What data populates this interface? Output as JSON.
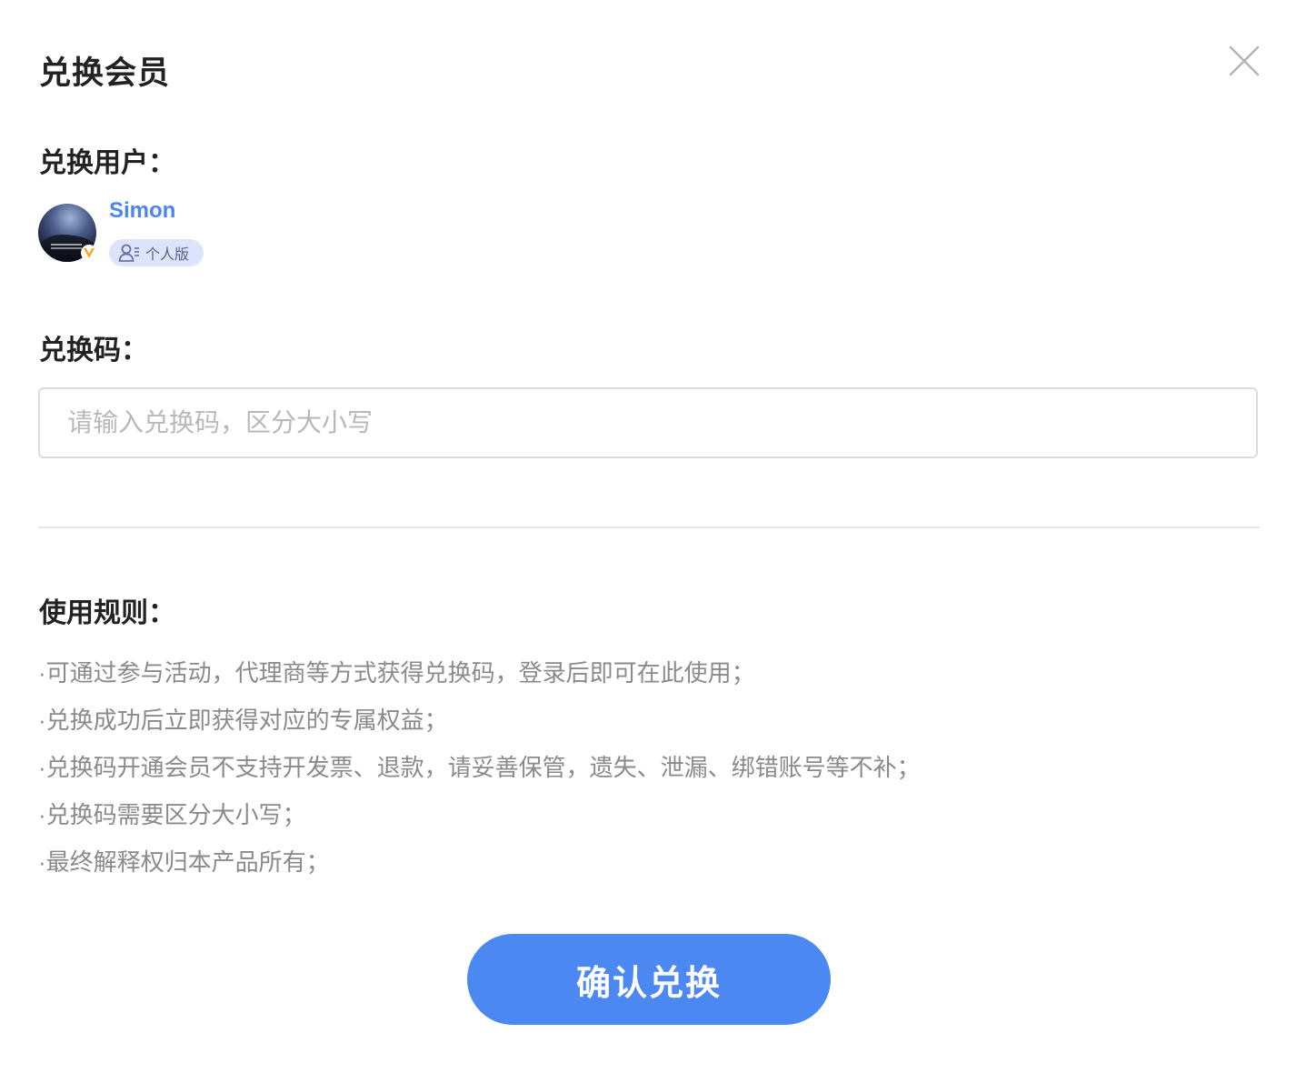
{
  "dialog": {
    "title": "兑换会员",
    "close_icon": "close-icon"
  },
  "user_section": {
    "label": "兑换用户：",
    "username": "Simon",
    "edition": "个人版",
    "edition_icon": "user-list-icon",
    "vip_icon": "vip-badge-icon"
  },
  "code_section": {
    "label": "兑换码：",
    "input_value": "",
    "placeholder": "请输入兑换码，区分大小写"
  },
  "rules": {
    "label": "使用规则：",
    "items": [
      "·可通过参与活动，代理商等方式获得兑换码，登录后即可在此使用；",
      "·兑换成功后立即获得对应的专属权益；",
      "·兑换码开通会员不支持开发票、退款，请妥善保管，遗失、泄漏、绑错账号等不补；",
      "·兑换码需要区分大小写；",
      "·最终解释权归本产品所有；"
    ]
  },
  "actions": {
    "confirm_label": "确认兑换"
  },
  "colors": {
    "accent": "#4c88f2",
    "username": "#4a86ee",
    "tag_bg": "#dde3fb",
    "muted_text": "#8a8a8a",
    "vip": "#f5a623"
  }
}
